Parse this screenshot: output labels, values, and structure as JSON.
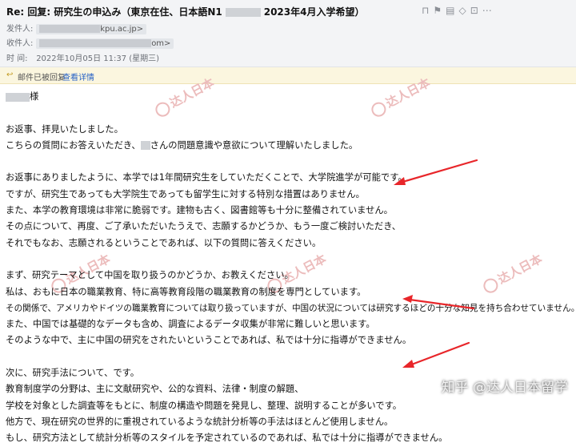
{
  "email": {
    "subject": {
      "prefix": "Re: 回复:   研究生の申込み（東京在住、日本語N1",
      "suffix": "2023年4月入学希望）"
    },
    "header_icons": [
      "bookmark-icon",
      "flag-icon",
      "document-icon",
      "tag-icon",
      "lock-icon",
      "more-icon"
    ],
    "from": {
      "label": "发件人:",
      "address_tail": "kpu.ac.jp>"
    },
    "to": {
      "label": "收件人:",
      "address_tail": "om>"
    },
    "time": {
      "label": "时   间:",
      "value": "2022年10月05日 11:37 (星期三)"
    }
  },
  "notice": {
    "text": "邮件已被回复",
    "link": "查看详情"
  },
  "body": {
    "salutation": "様",
    "p1": [
      "お返事、拝見いたしました。",
      {
        "pre": "こちらの質問にお答えいただき、",
        "post": "さんの問題意識や意欲について理解いたしました。"
      }
    ],
    "p2": [
      "お返事にありましたように、本学では1年間研究生をしていただくことで、大学院進学が可能です。",
      "ですが、研究生であっても大学院生であっても留学生に対する特別な措置はありません。",
      "また、本学の教育環境は非常に脆弱です。建物も古く、図書館等も十分に整備されていません。",
      "その点について、再度、ご了承いただいたうえで、志願するかどうか、もう一度ご検討いただき、",
      "それでもなお、志願されるということであれば、以下の質問に答えください。"
    ],
    "p3": [
      "まず、研究テーマとして中国を取り扱うのかどうか、お教えください。",
      "私は、おもに日本の職業教育、特に高等教育段階の職業教育の制度を専門としています。",
      "その関係で、アメリカやドイツの職業教育については取り扱っていますが、中国の状況については研究するほどの十分な知見を持ち合わせていません。",
      "また、中国では基礎的なデータも含め、調査によるデータ収集が非常に難しいと思います。",
      "そのような中で、主に中国の研究をされたいということであれば、私では十分に指導ができません。"
    ],
    "p4": [
      "次に、研究手法について、です。",
      "教育制度学の分野は、主に文献研究や、公的な資料、法律・制度の解題、",
      "学校を対象とした調査等をもとに、制度の構造や問題を発見し、整理、説明することが多いです。",
      "他方で、現在研究の世界的に重視されているような統計分析等の手法はほとんど使用しません。",
      "もし、研究方法として統計分析等のスタイルを予定されているのであれば、私では十分に指導ができません。"
    ]
  },
  "watermark": {
    "text": "达人日本"
  },
  "zhihu_watermark": "知乎 @达人日本留学",
  "colors": {
    "arrow": "#e8262a",
    "header_bg": "#f3f4f6",
    "notice_bg": "#fbf6df",
    "link": "#2863c6"
  }
}
